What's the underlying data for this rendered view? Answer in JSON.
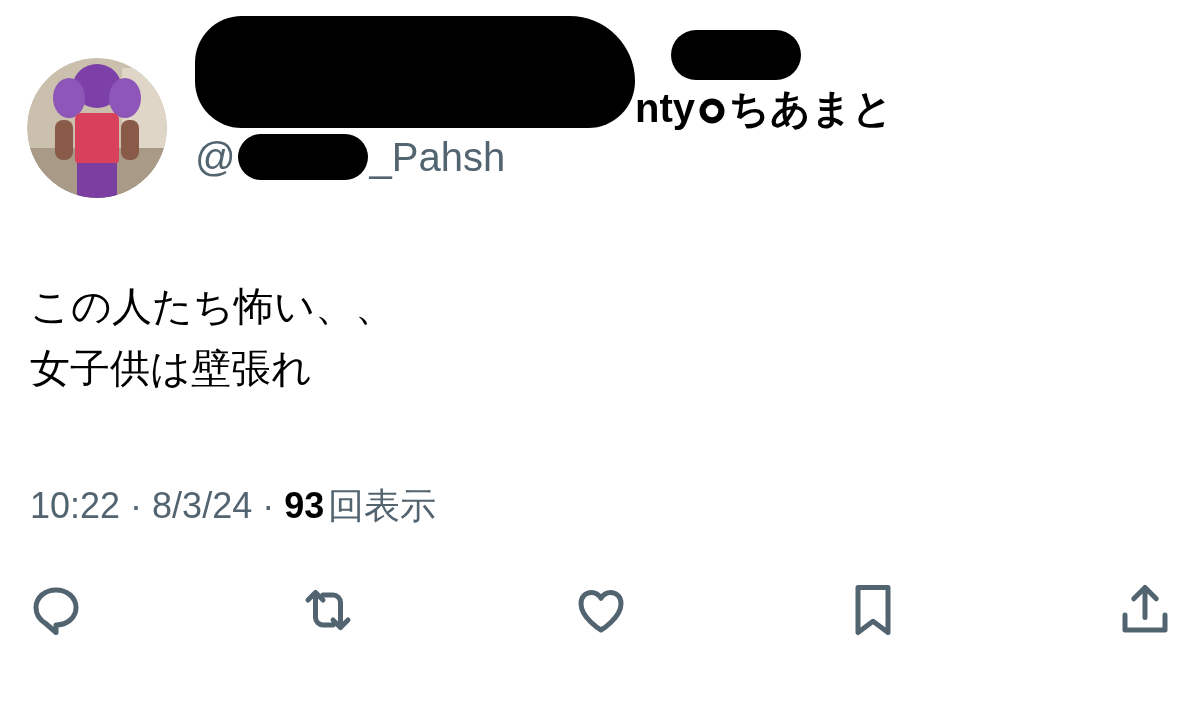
{
  "author": {
    "name_start": "nty",
    "name_end": "ちあまと",
    "handle_prefix": "@",
    "handle_suffix": "_Pahsh"
  },
  "text_lines": [
    "この人たち怖い、、",
    "女子供は壁張れ"
  ],
  "meta": {
    "time": "10:22",
    "separator": "·",
    "date": "8/3/24",
    "views": "93",
    "views_label": "回表示"
  },
  "actions": [
    {
      "kind": "reply"
    },
    {
      "kind": "repost"
    },
    {
      "kind": "like"
    },
    {
      "kind": "bookmark"
    },
    {
      "kind": "share"
    }
  ]
}
